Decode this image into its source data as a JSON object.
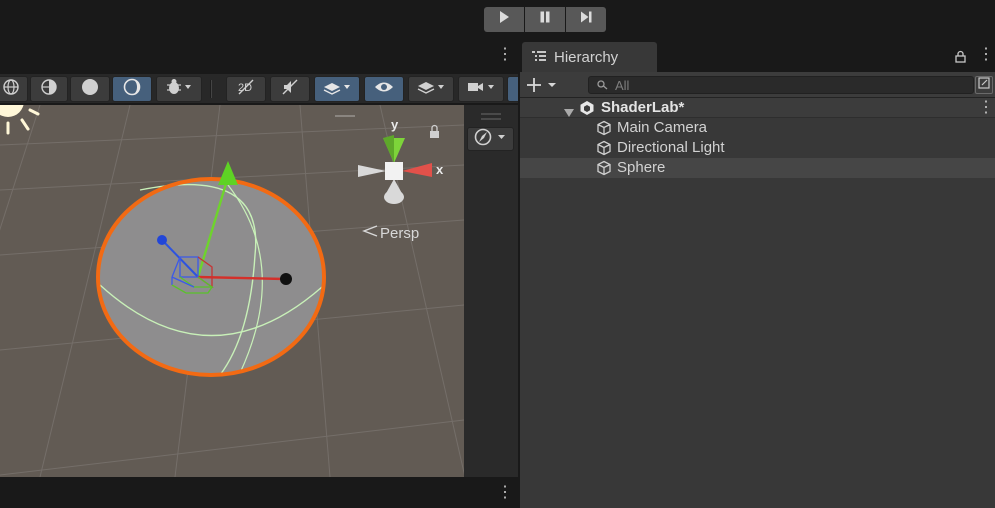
{
  "playbar": {
    "buttons": [
      {
        "name": "play-button",
        "icon": "play-icon"
      },
      {
        "name": "pause-button",
        "icon": "pause-icon"
      },
      {
        "name": "step-button",
        "icon": "step-icon"
      }
    ]
  },
  "scene": {
    "persp_label": "Persp",
    "gizmo_axes": {
      "y": "y",
      "x": "x"
    },
    "colors": {
      "selection": "#f26a13",
      "x_axis": "#d4302a",
      "y_axis": "#6ed42c",
      "z_axis": "#2d53e0",
      "active": "#46607c"
    }
  },
  "hierarchy": {
    "tab_label": "Hierarchy",
    "search_placeholder": "All",
    "scene_name": "ShaderLab*",
    "items": [
      {
        "label": "Main Camera"
      },
      {
        "label": "Directional Light"
      },
      {
        "label": "Sphere"
      }
    ]
  }
}
